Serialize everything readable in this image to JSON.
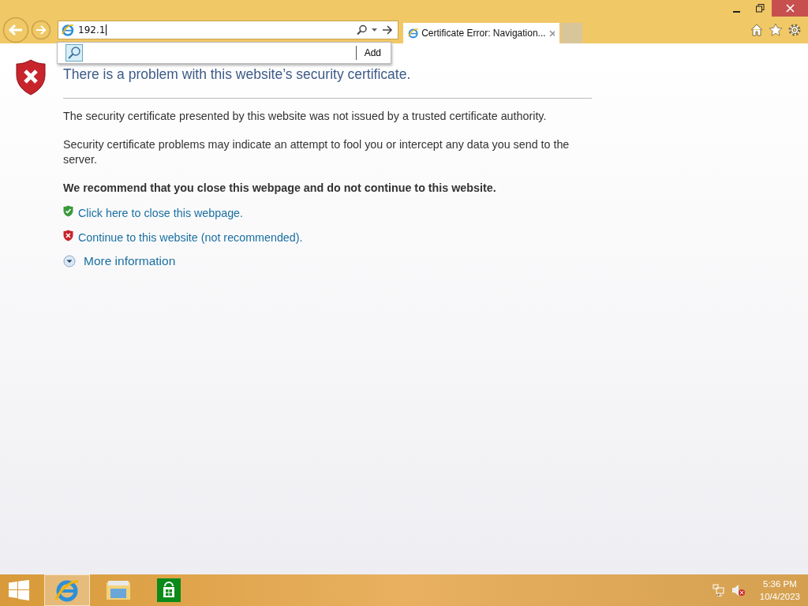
{
  "address_bar": {
    "value": "192.1"
  },
  "suggestion_popup": {
    "button": "Add"
  },
  "tabs": [
    {
      "title": "Certificate Error: Navigation...",
      "selected": true
    }
  ],
  "page": {
    "heading": "There is a problem with this website’s security certificate.",
    "paragraphs": [
      "The security certificate presented by this website was not issued by a trusted certificate authority.",
      "Security certificate problems may indicate an attempt to fool you or intercept any data you send to the server."
    ],
    "recommendation": "We recommend that you close this webpage and do not continue to this website.",
    "links": [
      {
        "kind": "safe",
        "text": "Click here to close this webpage."
      },
      {
        "kind": "unsafe",
        "text": "Continue to this website (not recommended)."
      }
    ],
    "more_info": {
      "text": "More information",
      "expanded": false
    }
  },
  "taskbar": {
    "apps": [
      {
        "kind": "browser",
        "selected": true
      },
      {
        "kind": "files",
        "selected": false
      },
      {
        "kind": "store",
        "selected": false
      }
    ],
    "clock": {
      "time": "5:36 PM",
      "date": "10/4/2023"
    }
  }
}
